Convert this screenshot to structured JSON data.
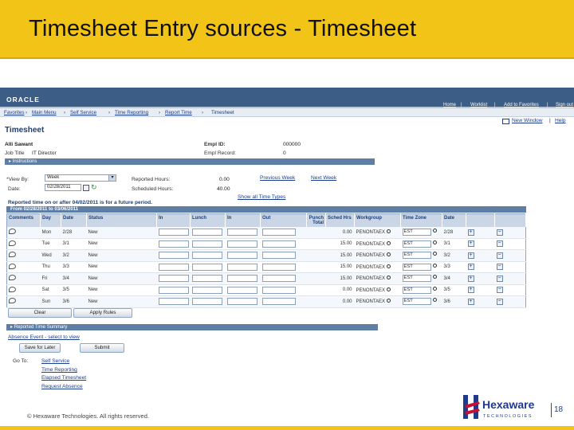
{
  "slide": {
    "title": "Timesheet Entry sources - Timesheet",
    "footer": "© Hexaware Technologies. All rights reserved.",
    "page_number": "18",
    "brand": {
      "name": "Hexaware",
      "tagline": "TECHNOLOGIES",
      "accent": "#f2c418",
      "logo_blue": "#1f3a8c",
      "logo_red": "#c8102e"
    }
  },
  "app": {
    "logo": "ORACLE",
    "top_links": [
      "Home",
      "Worklist",
      "Add to Favorites",
      "Sign out"
    ],
    "breadcrumb": [
      "Favorites",
      "Main Menu",
      "Self Service",
      "Time Reporting",
      "Report Time",
      "Timesheet"
    ],
    "new_window": "New Window",
    "help": "Help",
    "page_title": "Timesheet",
    "employee": {
      "name": "Alli Sawant",
      "job_title_label": "Job Title",
      "job_title": "IT Director",
      "empl_id_label": "Empl ID:",
      "empl_id": "000000",
      "empl_record_label": "Empl Record:",
      "empl_record": "0"
    },
    "instructions_label": "Instructions",
    "view_by_label": "*View By:",
    "view_by_value": "Week",
    "date_label": "Date:",
    "date_value": "02/28/2011",
    "reported_hours_label": "Reported Hours:",
    "reported_hours": "0.00",
    "scheduled_hours_label": "Scheduled Hours:",
    "scheduled_hours": "40.00",
    "previous_week": "Previous Week",
    "next_week": "Next Week",
    "show_all_time_types": "Show all Time Types",
    "future_note": "Reported time on or after 04/02/2011 is for a future period.",
    "period_header": "From 02/28/2011 to 03/06/2011",
    "columns": [
      "Comments",
      "Day",
      "Date",
      "Status",
      "In",
      "Lunch",
      "In",
      "Out",
      "Punch Total",
      "Sched Hrs",
      "Workgroup",
      "Time Zone",
      "Date",
      "",
      ""
    ],
    "rows": [
      {
        "day": "Mon",
        "date": "2/28",
        "status": "New",
        "sched": "0.00",
        "workgroup": "PENONTAEX",
        "tz": "EST",
        "date2": "2/28"
      },
      {
        "day": "Tue",
        "date": "3/1",
        "status": "New",
        "sched": "15.00",
        "workgroup": "PENONTAEX",
        "tz": "EST",
        "date2": "3/1"
      },
      {
        "day": "Wed",
        "date": "3/2",
        "status": "New",
        "sched": "15.00",
        "workgroup": "PENONTAEX",
        "tz": "EST",
        "date2": "3/2"
      },
      {
        "day": "Thu",
        "date": "3/3",
        "status": "New",
        "sched": "15.00",
        "workgroup": "PENONTAEX",
        "tz": "EST",
        "date2": "3/3"
      },
      {
        "day": "Fri",
        "date": "3/4",
        "status": "New",
        "sched": "15.00",
        "workgroup": "PENONTAEX",
        "tz": "EST",
        "date2": "3/4"
      },
      {
        "day": "Sat",
        "date": "3/5",
        "status": "New",
        "sched": "0.00",
        "workgroup": "PENONTAEX",
        "tz": "EST",
        "date2": "3/5"
      },
      {
        "day": "Sun",
        "date": "3/6",
        "status": "New",
        "sched": "0.00",
        "workgroup": "PENONTAEX",
        "tz": "EST",
        "date2": "3/6"
      }
    ],
    "clear_button": "Clear",
    "apply_rules_button": "Apply Rules",
    "reported_summary": "Reported Time Summary",
    "absence_event": "Absence Event - select to view",
    "save_later_button": "Save for Later",
    "submit_button": "Submit",
    "go_to_label": "Go To:",
    "go_to_links": [
      "Self Service",
      "Time Reporting",
      "Elapsed Timesheet",
      "Request Absence"
    ]
  }
}
